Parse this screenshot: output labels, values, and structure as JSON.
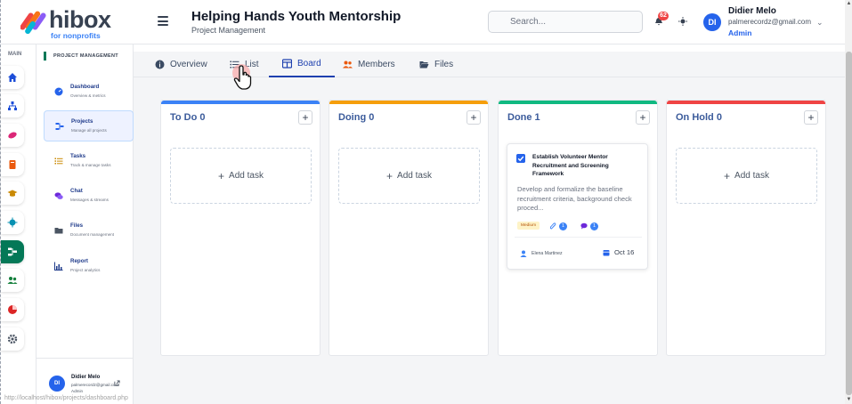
{
  "header": {
    "brand": "hibox",
    "brand_tag": "for nonprofits",
    "project_title": "Helping Hands Youth Mentorship",
    "project_subtitle": "Project Management",
    "search_placeholder": "Search...",
    "notification_count": "62",
    "user": {
      "initials": "DI",
      "name": "Didier Melo",
      "email": "palmerecordz@gmail.com",
      "role": "Admin"
    }
  },
  "rail": {
    "label": "MAIN",
    "items": [
      {
        "icon": "home-icon",
        "color": "#1d4ed8"
      },
      {
        "icon": "hierarchy-icon",
        "color": "#1d4ed8"
      },
      {
        "icon": "handshake-icon",
        "color": "#db2777"
      },
      {
        "icon": "book-icon",
        "color": "#ea580c"
      },
      {
        "icon": "graduation-cap-icon",
        "color": "#ca8a04"
      },
      {
        "icon": "virus-icon",
        "color": "#0891b2"
      },
      {
        "icon": "project-diagram-icon",
        "color": "#ffffff",
        "active": true
      },
      {
        "icon": "users-icon",
        "color": "#15803d"
      },
      {
        "icon": "pie-chart-icon",
        "color": "#dc2626"
      },
      {
        "icon": "gear-icon",
        "color": "#4b5563"
      }
    ]
  },
  "sidebar": {
    "heading": "PROJECT MANAGEMENT",
    "items": [
      {
        "title": "Dashboard",
        "desc": "Overview & metrics",
        "icon": "dashboard-icon"
      },
      {
        "title": "Projects",
        "desc": "Manage all projects",
        "icon": "project-diagram-icon",
        "active": true
      },
      {
        "title": "Tasks",
        "desc": "Track & manage tasks",
        "icon": "task-list-icon"
      },
      {
        "title": "Chat",
        "desc": "Messages & streams",
        "icon": "chat-icon"
      },
      {
        "title": "Files",
        "desc": "Document management",
        "icon": "folder-icon"
      },
      {
        "title": "Report",
        "desc": "Project analytics",
        "icon": "chart-icon"
      }
    ],
    "user": {
      "initials": "DI",
      "name": "Didier Melo",
      "email": "palmerecordz@gmail.com",
      "role": "Admin"
    }
  },
  "tabs": [
    {
      "label": "Overview",
      "icon": "info-icon"
    },
    {
      "label": "List",
      "icon": "list-icon"
    },
    {
      "label": "Board",
      "icon": "board-icon",
      "active": true
    },
    {
      "label": "Members",
      "icon": "users-icon"
    },
    {
      "label": "Files",
      "icon": "folder-open-icon"
    }
  ],
  "board": {
    "add_task_label": "Add task",
    "columns": [
      {
        "title": "To Do 0",
        "color": "#3b82f6"
      },
      {
        "title": "Doing 0",
        "color": "#f59e0b"
      },
      {
        "title": "Done 1",
        "color": "#10b981"
      },
      {
        "title": "On Hold 0",
        "color": "#ef4444"
      }
    ],
    "card": {
      "title": "Establish Volunteer Mentor Recruitment and Screening Framework",
      "description": "Develop and formalize the baseline recruitment criteria, background check proced...",
      "priority": "Medium",
      "attachments": "1",
      "comments": "1",
      "assignee": "Elena Martinez",
      "due": "Oct 16"
    }
  },
  "statusbar_text": "http://localhost/hibox/projects/dashboard.php"
}
